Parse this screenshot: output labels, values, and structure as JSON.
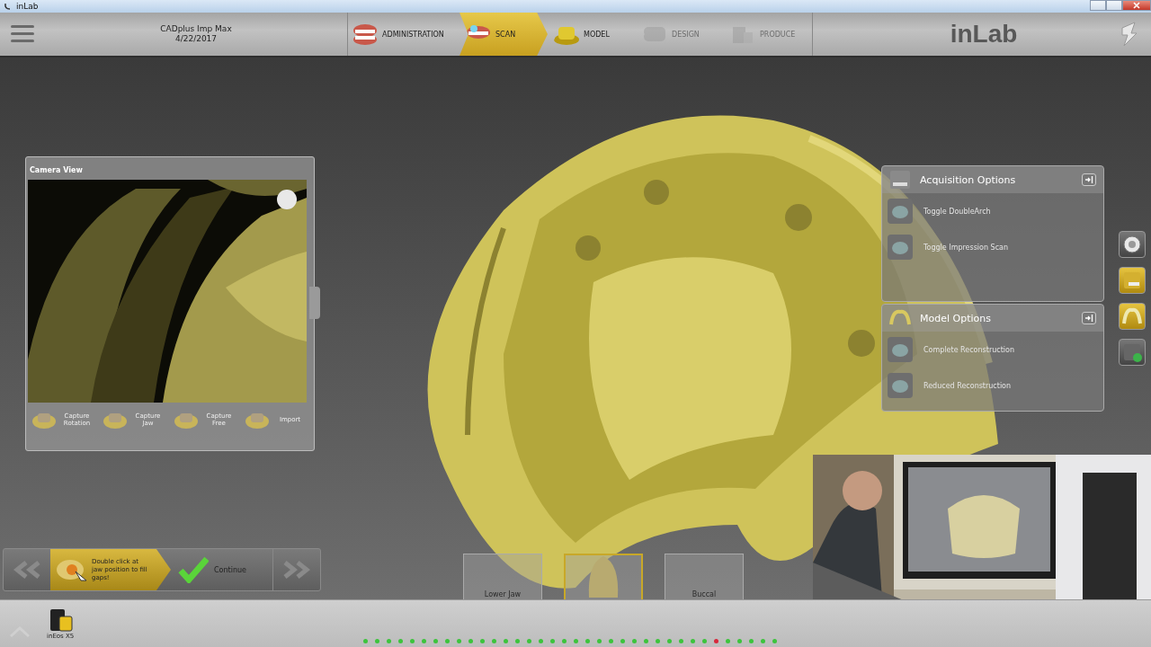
{
  "window": {
    "title": "inLab"
  },
  "case": {
    "name": "CADplus Imp Max",
    "date": "4/22/2017"
  },
  "phases": [
    {
      "label": "ADMINISTRATION",
      "selected": false,
      "disabled": false
    },
    {
      "label": "SCAN",
      "selected": true,
      "disabled": false
    },
    {
      "label": "MODEL",
      "selected": false,
      "disabled": false
    },
    {
      "label": "DESIGN",
      "selected": false,
      "disabled": true
    },
    {
      "label": "PRODUCE",
      "selected": false,
      "disabled": true
    }
  ],
  "brand": "inLab",
  "camera_view": {
    "title": "Camera View",
    "buttons": [
      {
        "label": "Capture Rotation"
      },
      {
        "label": "Capture Jaw"
      },
      {
        "label": "Capture Free"
      },
      {
        "label": "Import"
      }
    ]
  },
  "option_panels": [
    {
      "title": "Acquisition Options",
      "items": [
        "Toggle DoubleArch",
        "Toggle Impression Scan"
      ]
    },
    {
      "title": "Model Options",
      "items": [
        "Complete Reconstruction",
        "Reduced Reconstruction"
      ]
    }
  ],
  "side_buttons": [
    {
      "active": false
    },
    {
      "active": true
    },
    {
      "active": true
    },
    {
      "active": false
    }
  ],
  "wizard": {
    "hint": "Double click at jaw position to fill gaps!",
    "action": "Continue"
  },
  "scan_slots": [
    {
      "label": "Lower Jaw",
      "selected": false
    },
    {
      "selected": true
    },
    {
      "label": "Buccal",
      "selected": false
    }
  ],
  "device": {
    "label": "inEos X5"
  },
  "scan_dots": [
    {
      "color": "#3cc43c"
    },
    {
      "color": "#3cc43c"
    },
    {
      "color": "#3cc43c"
    },
    {
      "color": "#3cc43c"
    },
    {
      "color": "#3cc43c"
    },
    {
      "color": "#3cc43c"
    },
    {
      "color": "#3cc43c"
    },
    {
      "color": "#3cc43c"
    },
    {
      "color": "#3cc43c"
    },
    {
      "color": "#3cc43c"
    },
    {
      "color": "#3cc43c"
    },
    {
      "color": "#3cc43c"
    },
    {
      "color": "#3cc43c"
    },
    {
      "color": "#3cc43c"
    },
    {
      "color": "#3cc43c"
    },
    {
      "color": "#3cc43c"
    },
    {
      "color": "#3cc43c"
    },
    {
      "color": "#3cc43c"
    },
    {
      "color": "#3cc43c"
    },
    {
      "color": "#3cc43c"
    },
    {
      "color": "#3cc43c"
    },
    {
      "color": "#3cc43c"
    },
    {
      "color": "#3cc43c"
    },
    {
      "color": "#3cc43c"
    },
    {
      "color": "#3cc43c"
    },
    {
      "color": "#3cc43c"
    },
    {
      "color": "#3cc43c"
    },
    {
      "color": "#3cc43c"
    },
    {
      "color": "#3cc43c"
    },
    {
      "color": "#3cc43c"
    },
    {
      "color": "#d8283c"
    },
    {
      "color": "#3cc43c"
    },
    {
      "color": "#3cc43c"
    },
    {
      "color": "#3cc43c"
    },
    {
      "color": "#3cc43c"
    },
    {
      "color": "#3cc43c"
    }
  ]
}
